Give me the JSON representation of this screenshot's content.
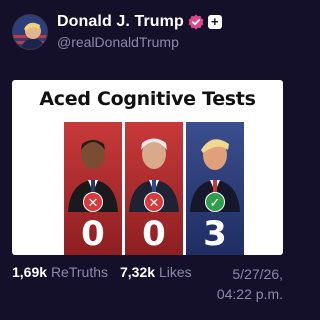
{
  "post": {
    "display_name": "Donald J. Trump",
    "handle": "@realDonaldTrump",
    "verified_icon": "verified-badge-icon",
    "plus_badge": "+",
    "image": {
      "title": "Aced Cognitive Tests",
      "panels": [
        {
          "result": "✕",
          "score": "0",
          "color": "#c8393a"
        },
        {
          "result": "✕",
          "score": "0",
          "color": "#c8393a"
        },
        {
          "result": "✓",
          "score": "3",
          "color": "#3b4e8e"
        }
      ]
    },
    "stats": {
      "retruths_value": "1,69k",
      "retruths_label": "ReTruths",
      "likes_value": "7,32k",
      "likes_label": "Likes",
      "date": "5/27/26,",
      "time": "04:22 p.m."
    }
  }
}
